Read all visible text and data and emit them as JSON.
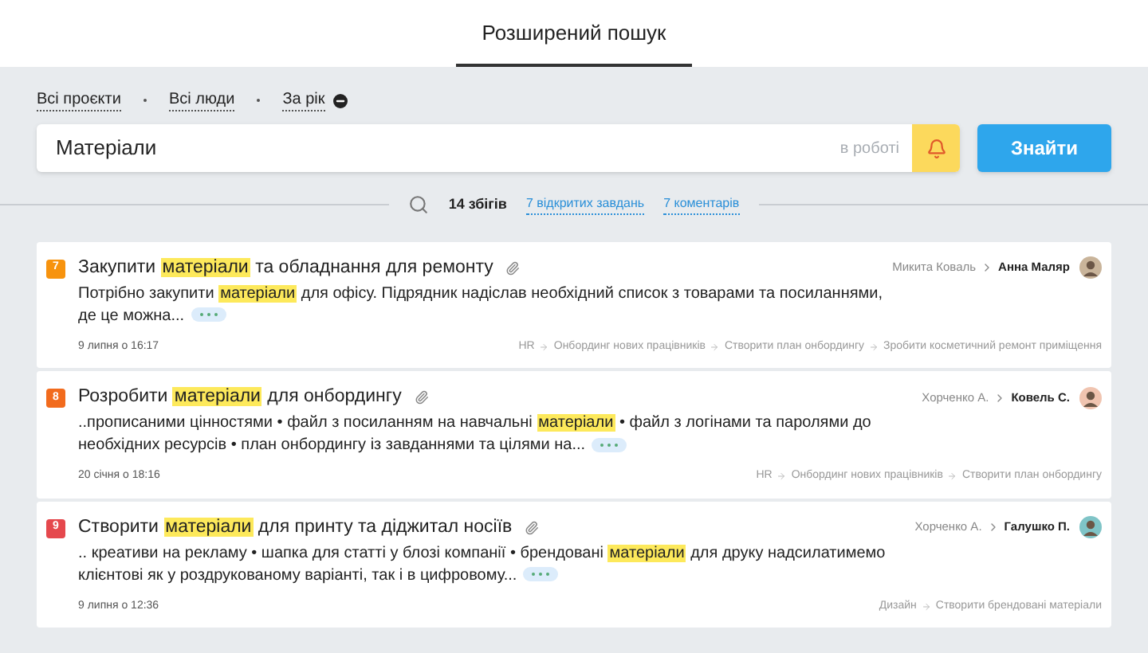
{
  "header": {
    "tab": {
      "label": "Розширений пошук",
      "selected": true
    }
  },
  "filters": [
    {
      "label": "Всі проєкти"
    },
    {
      "label": "Всі люди"
    },
    {
      "label": "За рік",
      "removable": true
    }
  ],
  "search": {
    "value": "Матеріали",
    "status": "в роботі",
    "bell_on": true,
    "button": "Знайти"
  },
  "summary": {
    "count": "14 збігів",
    "links": [
      "7 відкритих завдань",
      "7 коментарів"
    ]
  },
  "results": [
    {
      "number": "7",
      "color": "#f7930e",
      "title": [
        {
          "text": "Закупити "
        },
        {
          "text": "матеріали",
          "highlight": true
        },
        {
          "text": " та обладнання для ремонту"
        }
      ],
      "attachment": true,
      "from": "Микита Коваль",
      "to": "Анна Маляр",
      "snippet": [
        {
          "text": "Потрібно закупити "
        },
        {
          "text": "матеріали",
          "highlight": true
        },
        {
          "text": " для офісу. Підрядник надіслав необхідний список з товарами та посиланнями, де це можна..."
        }
      ],
      "date": "9 липня о 16:17",
      "path": [
        "HR",
        "Онбординг нових працівників",
        "Створити план онбордингу",
        "Зробити косметичний ремонт приміщення"
      ]
    },
    {
      "number": "8",
      "color": "#f26b1d",
      "title": [
        {
          "text": "Розробити "
        },
        {
          "text": "матеріали",
          "highlight": true
        },
        {
          "text": " для онбордингу"
        }
      ],
      "attachment": true,
      "from": "Хорченко А.",
      "to": "Ковель С.",
      "snippet": [
        {
          "text": "..прописаними цінностями • файл з посиланням на навчальні "
        },
        {
          "text": "матеріали",
          "highlight": true
        },
        {
          "text": " • файл з логінами та паролями до необхідних ресурсів • план онбордингу із завданнями та цілями на..."
        }
      ],
      "date": "20 січня о 18:16",
      "path": [
        "HR",
        "Онбординг нових працівників",
        "Створити план онбордингу"
      ]
    },
    {
      "number": "9",
      "color": "#e5484d",
      "title": [
        {
          "text": "Створити "
        },
        {
          "text": "матеріали",
          "highlight": true
        },
        {
          "text": " для принту та діджитал носіїв"
        }
      ],
      "attachment": true,
      "from": "Хорченко А.",
      "to": "Галушко П.",
      "snippet": [
        {
          "text": ".. креативи на рекламу • шапка для статті у блозі компанії • брендовані "
        },
        {
          "text": "матеріали",
          "highlight": true
        },
        {
          "text": " для друку надсилатимемо клієнтові як у роздрукованому варіанті, так і в цифровому..."
        }
      ],
      "date": "9 липня о 12:36",
      "path": [
        "Дизайн",
        "Створити брендовані матеріали"
      ]
    }
  ]
}
